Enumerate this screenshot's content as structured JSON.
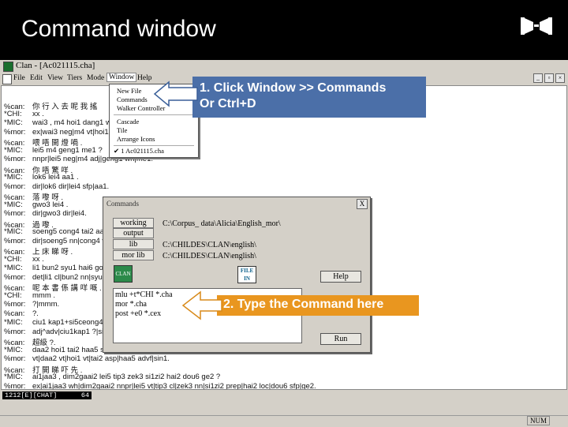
{
  "slide": {
    "title": "Command window"
  },
  "window": {
    "title": "Clan - [Ac021115.cha]",
    "menu": [
      "File",
      "Edit",
      "View",
      "Tiers",
      "Mode",
      "Window",
      "Help"
    ],
    "active_menu": "Window"
  },
  "window_menu": {
    "group1": [
      "New File",
      "Commands",
      "Walker Controller"
    ],
    "group2": [
      "Cascade",
      "Tile",
      "Arrange Icons"
    ],
    "group3": [
      "✔ 1 Ac021115.cha"
    ]
  },
  "transcript": [
    {
      "tier": "%can:",
      "text": "你 行 入 去 呢 我 搖"
    },
    {
      "tier": "*CHI:",
      "text": "xx ."
    },
    {
      "tier": "*MIC:",
      "text": "wai3 , m4 hoi1 dang1 wo"
    },
    {
      "tier": "%mor:",
      "text": "ex|wai3 neg|m4 vt|hoi1"
    },
    {
      "tier": "%can:",
      "text": "喂 唔 開 燈 喎 ."
    },
    {
      "tier": "*MIC:",
      "text": "lei5 m4 geng1 me1 ?"
    },
    {
      "tier": "%mor:",
      "text": "nnpr|lei5 neg|m4 adj|geng1 wh|me1."
    },
    {
      "tier": "%can:",
      "text": "你 唔 驚 咩 ."
    },
    {
      "tier": "*MIC:",
      "text": "lok6 lei4 aa1 ."
    },
    {
      "tier": "%mor:",
      "text": "dir|lok6 dir|lei4 sfp|aa1."
    },
    {
      "tier": "%can:",
      "text": "落 嚟 呀 ."
    },
    {
      "tier": "*MIC:",
      "text": "gwo3 lei4 ."
    },
    {
      "tier": "%mor:",
      "text": "dir|gwo3 dir|lei4."
    },
    {
      "tier": "%can:",
      "text": "過 嚟 ."
    },
    {
      "tier": "*MIC:",
      "text": "soeng5 cong4 tai2 aa"
    },
    {
      "tier": "%mor:",
      "text": "dir|soeng5 nn|cong4 vt"
    },
    {
      "tier": "%can:",
      "text": "上 床 睇 呀 ."
    },
    {
      "tier": "*CHI:",
      "text": "xx ."
    },
    {
      "tier": "*MIC:",
      "text": "li1 bun2 syu1 hai6 gong"
    },
    {
      "tier": "%mor:",
      "text": "det|li1 cl|bun2 nn|syu1"
    },
    {
      "tier": "%can:",
      "text": "呢 本 書 係 講 咩 嘅 ."
    },
    {
      "tier": "*CHI:",
      "text": "mmm ."
    },
    {
      "tier": "%mor:",
      "text": "?|mmm."
    },
    {
      "tier": "%can:",
      "text": "?."
    },
    {
      "tier": "*MIC:",
      "text": "ciu1 kap1+si5ceong4"
    },
    {
      "tier": "%mor:",
      "text": "adj^adv|ciu1kap1 ?|si5"
    },
    {
      "tier": "%can:",
      "text": "超級 ?."
    },
    {
      "tier": "*MIC:",
      "text": "daa2 hoi1 tai2 haa5 sin"
    },
    {
      "tier": "%mor:",
      "text": "vt|daa2 vt|hoi1 vt|tai2 asp|haa5 advf|sin1."
    },
    {
      "tier": "%can:",
      "text": "打 開 睇 吓 先 ."
    },
    {
      "tier": "*MIC:",
      "text": "ai1jaa3 , dim2gaai2 lei5 tip3 zek3 si1zi2 hai2 dou6 ge2 ?"
    },
    {
      "tier": "%mor:",
      "text": "ex|ai1jaa3 wh|dim2gaai2 nnpr|lei5 vt|tip3 cl|zek3 nn|si1zi2 prep|hai2 loc|dou6 sfp|ge2."
    }
  ],
  "status": {
    "position": "1212[E][CHAT]",
    "col": "64",
    "num": "NUM"
  },
  "dialog": {
    "title": "Commands",
    "close": "X",
    "buttons": [
      "working",
      "output",
      "lib",
      "mor lib"
    ],
    "paths": [
      "C:\\Corpus_ data\\Alicia\\English_mor\\",
      "",
      "C:\\CHILDES\\CLAN\\english\\",
      "C:\\CHILDES\\CLAN\\english\\"
    ],
    "clan_icon": "CLAN",
    "file_in_top": "FILE",
    "file_in_bottom": "IN",
    "help_button": "Help",
    "run_button": "Run",
    "commands": [
      "mlu +t*CHI *.cha",
      "mor *.cha",
      "post +e0 *.cex"
    ]
  },
  "callouts": {
    "step1_line1": "1. Click Window >> Commands",
    "step1_line2": "Or Ctrl+D",
    "step2": "2. Type the Command here"
  },
  "colors": {
    "callout_blue": "#4b6fa8",
    "callout_orange": "#e9961f"
  }
}
